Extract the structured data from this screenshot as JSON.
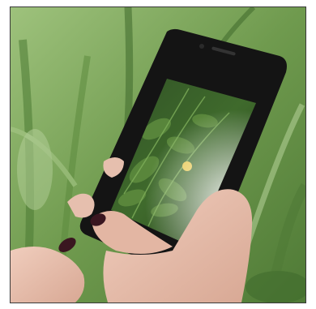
{
  "scene": {
    "subject": "hands-holding-smartphone",
    "colors": {
      "grass_dark": "#3f6a2c",
      "grass_mid": "#6f9a4e",
      "grass_light": "#a9c98a",
      "phone_body": "#151515",
      "nail_polish": "#3a1620",
      "skin": "#e8c2b0",
      "flower": "#e6c64a"
    }
  }
}
